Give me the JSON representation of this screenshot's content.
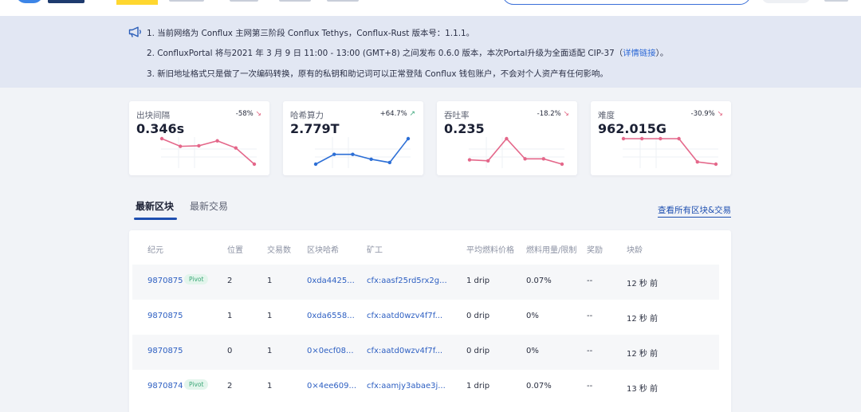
{
  "notice": {
    "line1": "1. 当前网络为 Conflux 主网第三阶段 Conflux Tethys，Conflux-Rust 版本号：1.1.1。",
    "line2_pre": "2. ConfluxPortal 将与2021 年 3 月 9 日 11:00 - 13:00 (GMT+8) 之间发布 0.6.0 版本，本次Portal升级为全面适配 CIP-37（",
    "line2_link": "详情链接",
    "line2_post": "）。",
    "line3": "3. 新旧地址格式只是做了一次编码转换，原有的私钥和助记词可以正常登陆 Conflux 钱包账户，不会对个人资产有任何影响。"
  },
  "stats": [
    {
      "title": "出块间隔",
      "change": "-58%",
      "trend": "down",
      "value": "0.346s",
      "color": "#e4678a",
      "series": [
        5,
        3.6,
        3.7,
        4.6,
        3.3,
        0.346
      ]
    },
    {
      "title": "哈希算力",
      "change": "+64.7%",
      "trend": "up",
      "value": "2.779T",
      "color": "#2d6fd6",
      "series": [
        2.0,
        2.3,
        2.3,
        2.15,
        2.05,
        2.779
      ]
    },
    {
      "title": "吞吐率",
      "change": "-18.2%",
      "trend": "down",
      "value": "0.235",
      "color": "#e4678a",
      "series": [
        0.28,
        0.27,
        0.5,
        0.29,
        0.29,
        0.235
      ]
    },
    {
      "title": "难度",
      "change": "-30.9%",
      "trend": "down",
      "value": "962.015G",
      "color": "#e4678a",
      "series": [
        1390,
        1390,
        1390,
        1390,
        1000,
        962.015
      ]
    }
  ],
  "tabs": {
    "active": "最新区块",
    "second": "最新交易"
  },
  "view_all": "查看所有区块&交易",
  "table": {
    "headers": [
      "纪元",
      "位置",
      "交易数",
      "区块哈希",
      "矿工",
      "平均燃料价格",
      "燃料用量/限制",
      "奖励",
      "块龄"
    ],
    "rows": [
      {
        "epoch": "9870875",
        "pivot": "Pivot",
        "position": "2",
        "txs": "1",
        "hash": "0xda4425...",
        "miner": "cfx:aasf25rd5rx2g...",
        "gas_price": "1 drip",
        "gas_used": "0.07%",
        "reward": "--",
        "age": "12 秒 前"
      },
      {
        "epoch": "9870875",
        "pivot": "",
        "position": "1",
        "txs": "1",
        "hash": "0xda6558...",
        "miner": "cfx:aatd0wzv4f7f...",
        "gas_price": "0 drip",
        "gas_used": "0%",
        "reward": "--",
        "age": "12 秒 前"
      },
      {
        "epoch": "9870875",
        "pivot": "",
        "position": "0",
        "txs": "1",
        "hash": "0×0ecf08...",
        "miner": "cfx:aatd0wzv4f7f...",
        "gas_price": "0 drip",
        "gas_used": "0%",
        "reward": "--",
        "age": "12 秒 前"
      },
      {
        "epoch": "9870874",
        "pivot": "Pivot",
        "position": "2",
        "txs": "1",
        "hash": "0×4ee609...",
        "miner": "cfx:aamjy3abae3j...",
        "gas_price": "1 drip",
        "gas_used": "0.07%",
        "reward": "--",
        "age": "13 秒 前"
      }
    ]
  }
}
